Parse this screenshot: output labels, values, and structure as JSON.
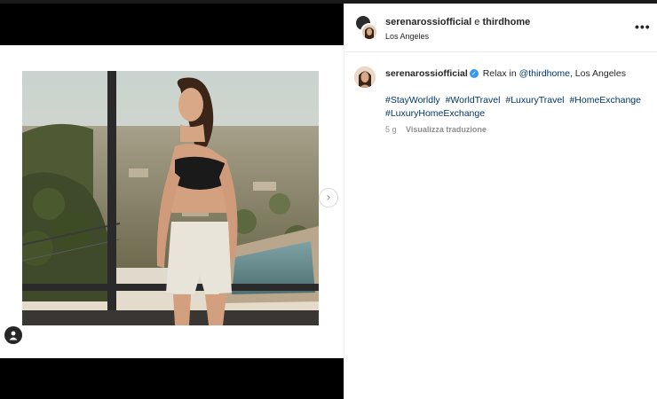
{
  "post": {
    "header": {
      "author": "serenarossiofficial",
      "conjunction": "e",
      "coauthor": "thirdhome",
      "location": "Los Angeles",
      "more_label": "•••"
    },
    "caption": {
      "username": "serenarossiofficial",
      "verified_mark": "✓",
      "text_before": "Relax in",
      "mention": "@thirdhome",
      "text_after": ", Los Angeles",
      "hashtags": [
        "#StayWorldly",
        "#WorldTravel",
        "#LuxuryTravel",
        "#HomeExchange",
        "#LuxuryHomeExchange"
      ]
    },
    "meta": {
      "age": "5 g",
      "translate_label": "Visualizza traduzione"
    },
    "media": {
      "next_arrow": "›",
      "user_tag_icon": "person-icon"
    }
  },
  "colors": {
    "link": "#003569",
    "verified": "#3897f0",
    "muted": "#8e8e8e",
    "text": "#262626"
  }
}
